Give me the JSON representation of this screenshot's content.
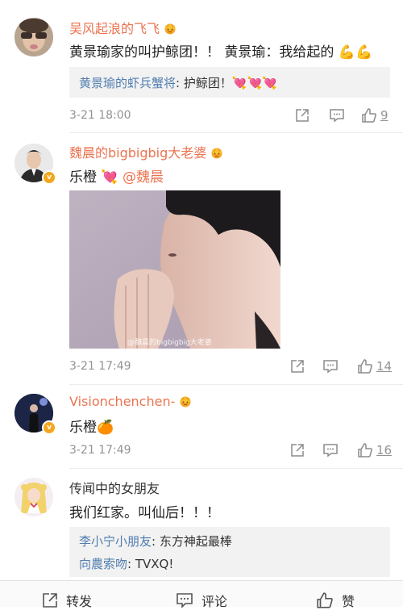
{
  "comments": [
    {
      "username": "吴风起浪的飞飞",
      "text": "黄景瑜家的叫护鲸团！！ 黄景瑜：我给起的",
      "text_emojis": "💪💪",
      "replies": [
        {
          "name": "黄景瑜的虾兵蟹将",
          "text": ": 护鲸团！",
          "emojis": "💘💘💘"
        }
      ],
      "time": "3-21 18:00",
      "likes": "9"
    },
    {
      "username": "魏晨的bigbigbig大老婆",
      "text": "乐橙",
      "text_emoji": "💘",
      "mention": "@魏晨",
      "image_watermark": "@魏晨的bigbigbig大老婆",
      "time": "3-21 17:49",
      "likes": "14"
    },
    {
      "username": "Visionchenchen-",
      "text": "乐橙",
      "text_emoji": "🍊",
      "time": "3-21 17:49",
      "likes": "16"
    },
    {
      "username": "传闻中的女朋友",
      "text": "我们红家。叫仙后！！！",
      "replies": [
        {
          "name": "李小宁小朋友",
          "text": ": 东方神起最棒"
        },
        {
          "name": "向農索吻",
          "text": ": TVXQ!"
        }
      ]
    }
  ],
  "bottom_bar": {
    "repost": "转发",
    "comment": "评论",
    "like": "赞"
  },
  "colors": {
    "username": "#eb7350",
    "reply_name": "#507daf",
    "meta": "#939393",
    "reply_bg": "#f2f2f2",
    "badge": "#f4a71d"
  }
}
